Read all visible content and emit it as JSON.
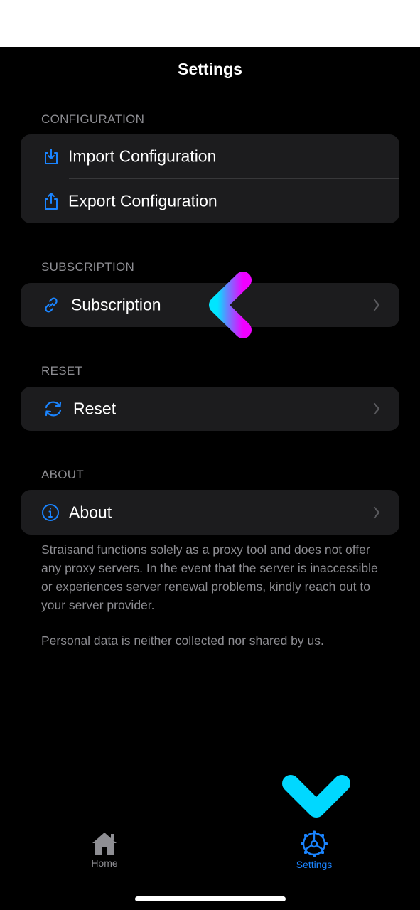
{
  "nav": {
    "title": "Settings"
  },
  "sections": {
    "configuration": {
      "header": "CONFIGURATION",
      "items": [
        {
          "label": "Import Configuration",
          "icon": "import-icon"
        },
        {
          "label": "Export Configuration",
          "icon": "export-icon"
        }
      ]
    },
    "subscription": {
      "header": "SUBSCRIPTION",
      "items": [
        {
          "label": "Subscription",
          "icon": "link-icon"
        }
      ]
    },
    "reset": {
      "header": "RESET",
      "items": [
        {
          "label": "Reset",
          "icon": "refresh-icon"
        }
      ]
    },
    "about": {
      "header": "ABOUT",
      "items": [
        {
          "label": "About",
          "icon": "info-icon"
        }
      ]
    }
  },
  "footer": {
    "paragraph1": "Straisand functions solely as a proxy tool and does not offer any proxy servers. In the event that the server is inaccessible or experiences server renewal problems, kindly reach out to your server provider.",
    "paragraph2": "Personal data is neither collected nor shared by us."
  },
  "tabbar": {
    "tabs": [
      {
        "label": "Home",
        "icon": "house-icon",
        "active": false
      },
      {
        "label": "Settings",
        "icon": "gear-icon",
        "active": true
      }
    ]
  },
  "colors": {
    "accent": "#1a84ff",
    "inactive": "#8e8e93",
    "row_bg": "#1c1c1e",
    "arrow_gradient_start": "#00e5ff",
    "arrow_gradient_end": "#f000ff"
  }
}
